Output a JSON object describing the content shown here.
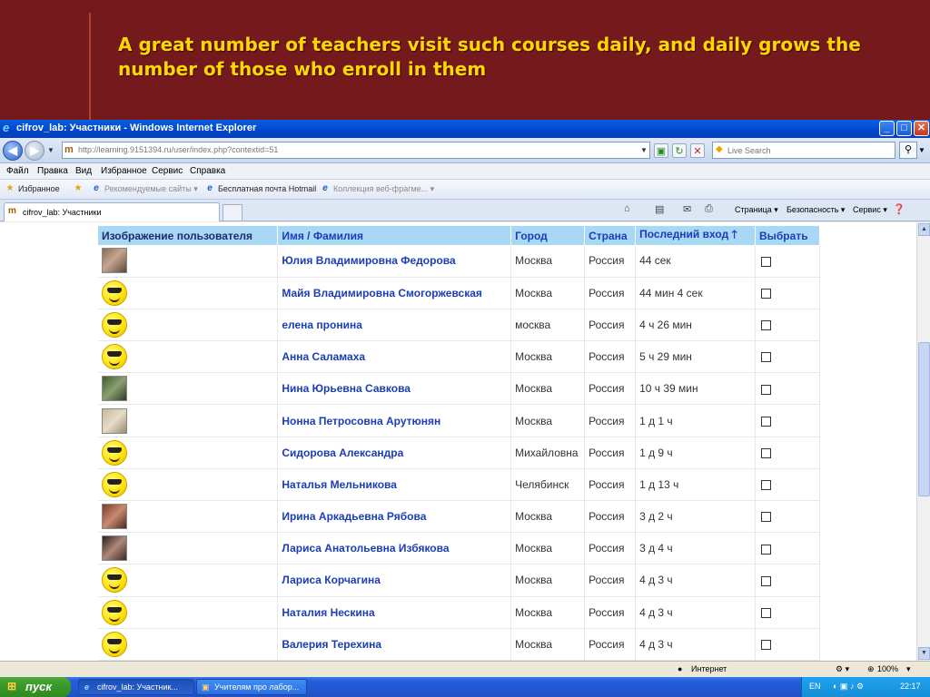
{
  "slide": {
    "title": "A great number of teachers visit such courses daily, and daily grows the number of those who enroll in them"
  },
  "window": {
    "title": "cifrov_lab: Участники - Windows Internet Explorer",
    "min": "_",
    "max": "□",
    "close": "✕"
  },
  "address": {
    "back": "◀",
    "forward": "▶",
    "url": "http://learning.9151394.ru/user/index.php?contextid=51",
    "search_placeholder": "Live Search"
  },
  "menu": [
    "Файл",
    "Правка",
    "Вид",
    "Избранное",
    "Сервис",
    "Справка"
  ],
  "favorites": {
    "label": "Избранное",
    "items": [
      "Рекомендуемые сайты ▾",
      "Бесплатная почта Hotmail",
      "Коллекция веб-фрагме... ▾"
    ]
  },
  "tab": {
    "label": "cifrov_lab: Участники"
  },
  "commands": [
    "Страница ▾",
    "Безопасность ▾",
    "Сервис ▾"
  ],
  "table": {
    "headers": [
      "Изображение пользователя",
      "Имя / Фамилия",
      "Город",
      "Страна",
      "Последний вход 🡑",
      "Выбрать"
    ],
    "rows": [
      {
        "avatar": "photo",
        "name": "Юлия Владимировна Федорова",
        "city": "Москва",
        "country": "Россия",
        "last": "44 сек"
      },
      {
        "avatar": "smiley",
        "name": "Майя Владимировна Смогоржевская",
        "city": "Москва",
        "country": "Россия",
        "last": "44 мин 4 сек"
      },
      {
        "avatar": "smiley",
        "name": "елена пронина",
        "city": "москва",
        "country": "Россия",
        "last": "4 ч 26 мин"
      },
      {
        "avatar": "smiley",
        "name": "Анна Саламаха",
        "city": "Москва",
        "country": "Россия",
        "last": "5 ч 29 мин"
      },
      {
        "avatar": "photo-green",
        "name": "Нина Юрьевна Савкова",
        "city": "Москва",
        "country": "Россия",
        "last": "10 ч 39 мин"
      },
      {
        "avatar": "photo-light",
        "name": "Нонна Петросовна Арутюнян",
        "city": "Москва",
        "country": "Россия",
        "last": "1 д 1 ч"
      },
      {
        "avatar": "smiley",
        "name": "Сидорова Александра",
        "city": "Михайловна",
        "country": "Россия",
        "last": "1 д 9 ч"
      },
      {
        "avatar": "smiley",
        "name": "Наталья Мельникова",
        "city": "Челябинск",
        "country": "Россия",
        "last": "1 д 13 ч"
      },
      {
        "avatar": "photo-red",
        "name": "Ирина Аркадьевна Рябова",
        "city": "Москва",
        "country": "Россия",
        "last": "3 д 2 ч"
      },
      {
        "avatar": "photo-dark",
        "name": "Лариса Анатольевна Избякова",
        "city": "Москва",
        "country": "Россия",
        "last": "3 д 4 ч"
      },
      {
        "avatar": "smiley",
        "name": "Лариса Корчагина",
        "city": "Москва",
        "country": "Россия",
        "last": "4 д 3 ч"
      },
      {
        "avatar": "smiley",
        "name": "Наталия Нескина",
        "city": "Москва",
        "country": "Россия",
        "last": "4 д 3 ч"
      },
      {
        "avatar": "smiley",
        "name": "Валерия Терехина",
        "city": "Москва",
        "country": "Россия",
        "last": "4 д 3 ч"
      }
    ]
  },
  "status": {
    "zone": "Интернет",
    "zoom": "100%"
  },
  "taskbar": {
    "start": "пуск",
    "tasks": [
      "cifrov_lab: Участник...",
      "Учителям про лабор..."
    ],
    "lang": "EN",
    "clock": "22:17"
  }
}
